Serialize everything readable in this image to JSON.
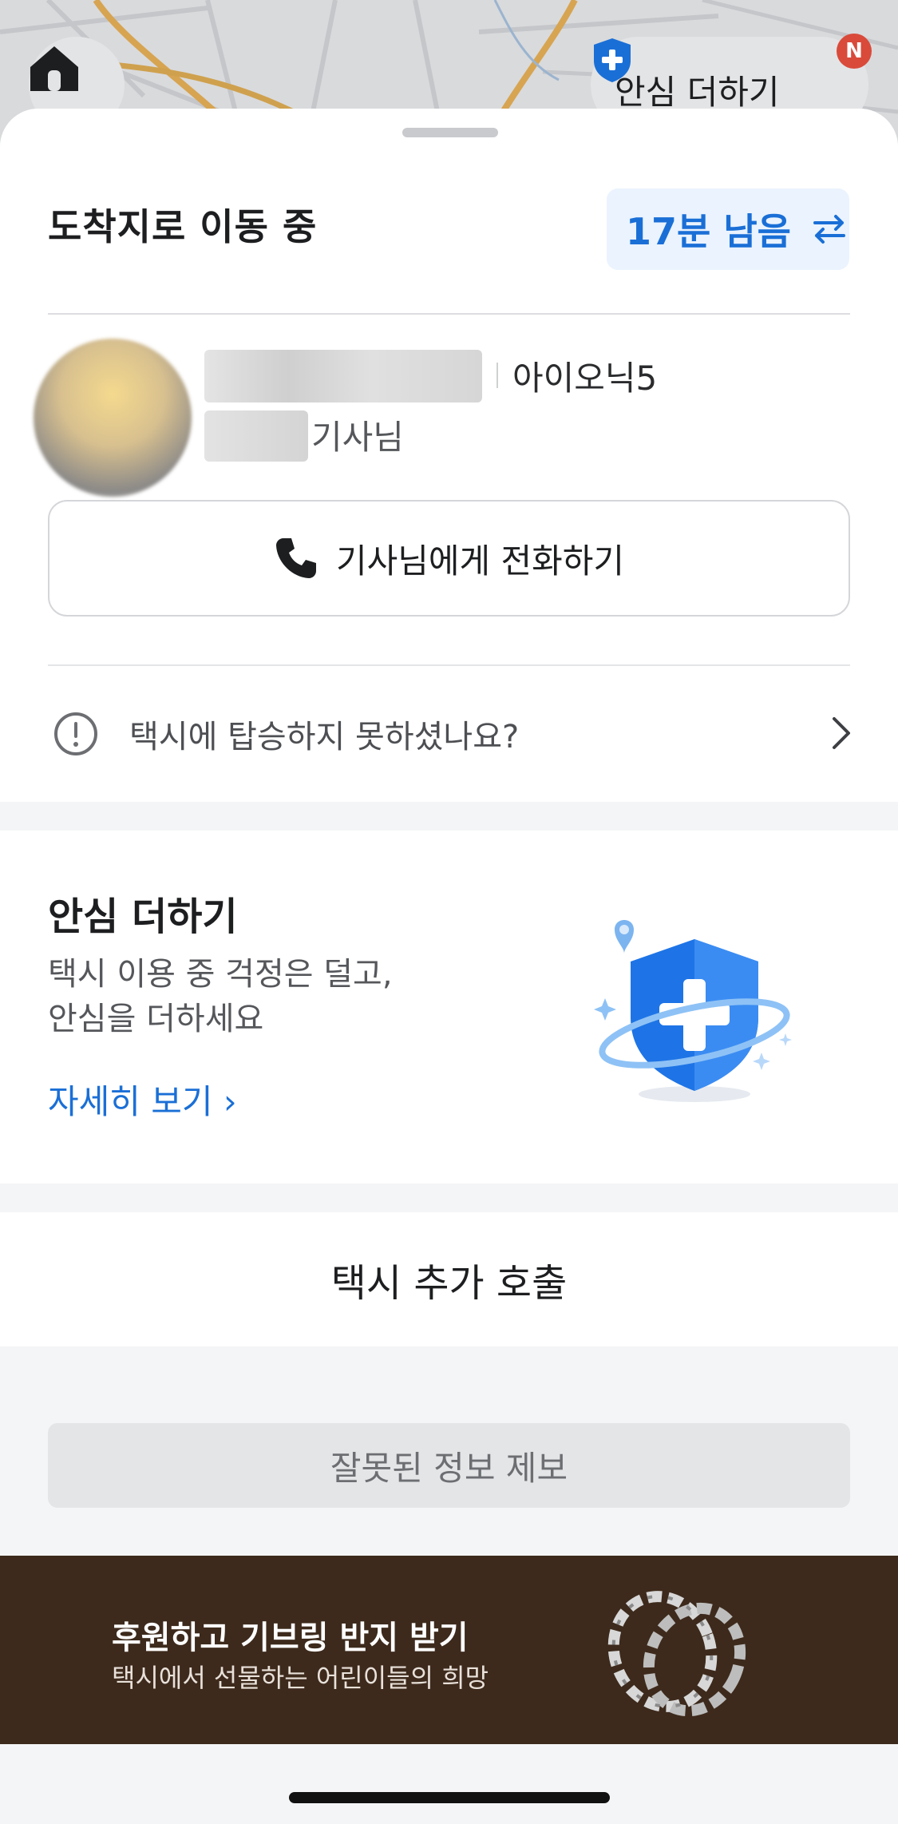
{
  "map": {
    "safety_pill_label": "안심 더하기",
    "badge": "N"
  },
  "header": {
    "status_title": "도착지로 이동 중",
    "time_remaining": "17분 남음"
  },
  "driver": {
    "car_model": "아이오닉5",
    "suffix": "기사님",
    "call_label": "기사님에게 전화하기"
  },
  "no_board": {
    "label": "택시에 탑승하지 못하셨나요?"
  },
  "safety": {
    "title": "안심 더하기",
    "desc": "택시 이용 중 걱정은 덜고,\n안심을 더하세요",
    "more": "자세히 보기 ›"
  },
  "extra_call": {
    "label": "택시 추가 호출"
  },
  "report": {
    "label": "잘못된 정보 제보"
  },
  "banner": {
    "title": "후원하고 기브링 반지 받기",
    "subtitle": "택시에서 선물하는 어린이들의 희망"
  },
  "colors": {
    "accent": "#1a6fd6",
    "banner_bg": "#3d2a1c",
    "badge": "#d94a3a"
  }
}
